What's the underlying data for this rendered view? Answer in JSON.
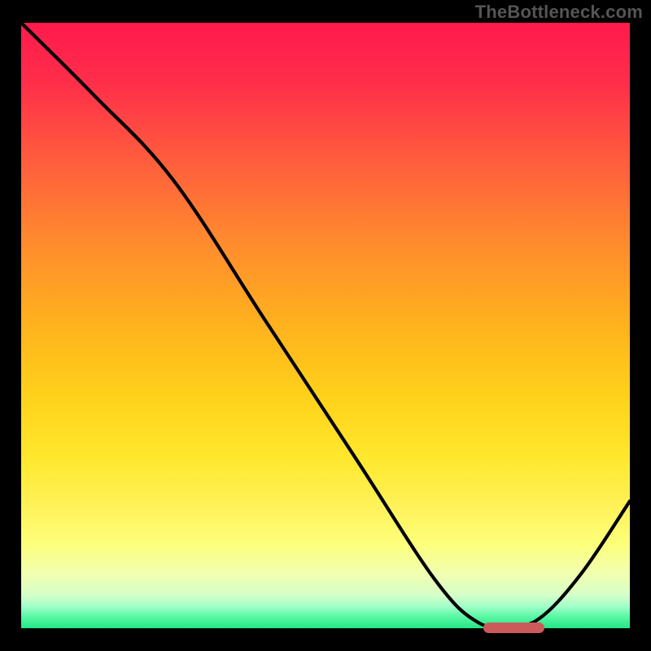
{
  "watermark": "TheBottleneck.com",
  "chart_data": {
    "type": "line",
    "title": "",
    "xlabel": "",
    "ylabel": "",
    "xlim": [
      0,
      100
    ],
    "ylim": [
      0,
      100
    ],
    "grid": false,
    "legend": null,
    "series": [
      {
        "name": "curve",
        "x": [
          0,
          12,
          25,
          40,
          55,
          68,
          75,
          80,
          85,
          92,
          100
        ],
        "y": [
          100,
          88,
          74,
          51,
          28,
          8,
          1,
          0.5,
          1.5,
          9,
          21
        ]
      }
    ],
    "marker": {
      "x_start": 76,
      "x_end": 86,
      "y": 0
    },
    "gradient_stops": [
      {
        "pos": 0.0,
        "color": "#ff1a4c"
      },
      {
        "pos": 0.5,
        "color": "#ffb21e"
      },
      {
        "pos": 0.8,
        "color": "#fff25a"
      },
      {
        "pos": 1.0,
        "color": "#22e884"
      }
    ]
  }
}
